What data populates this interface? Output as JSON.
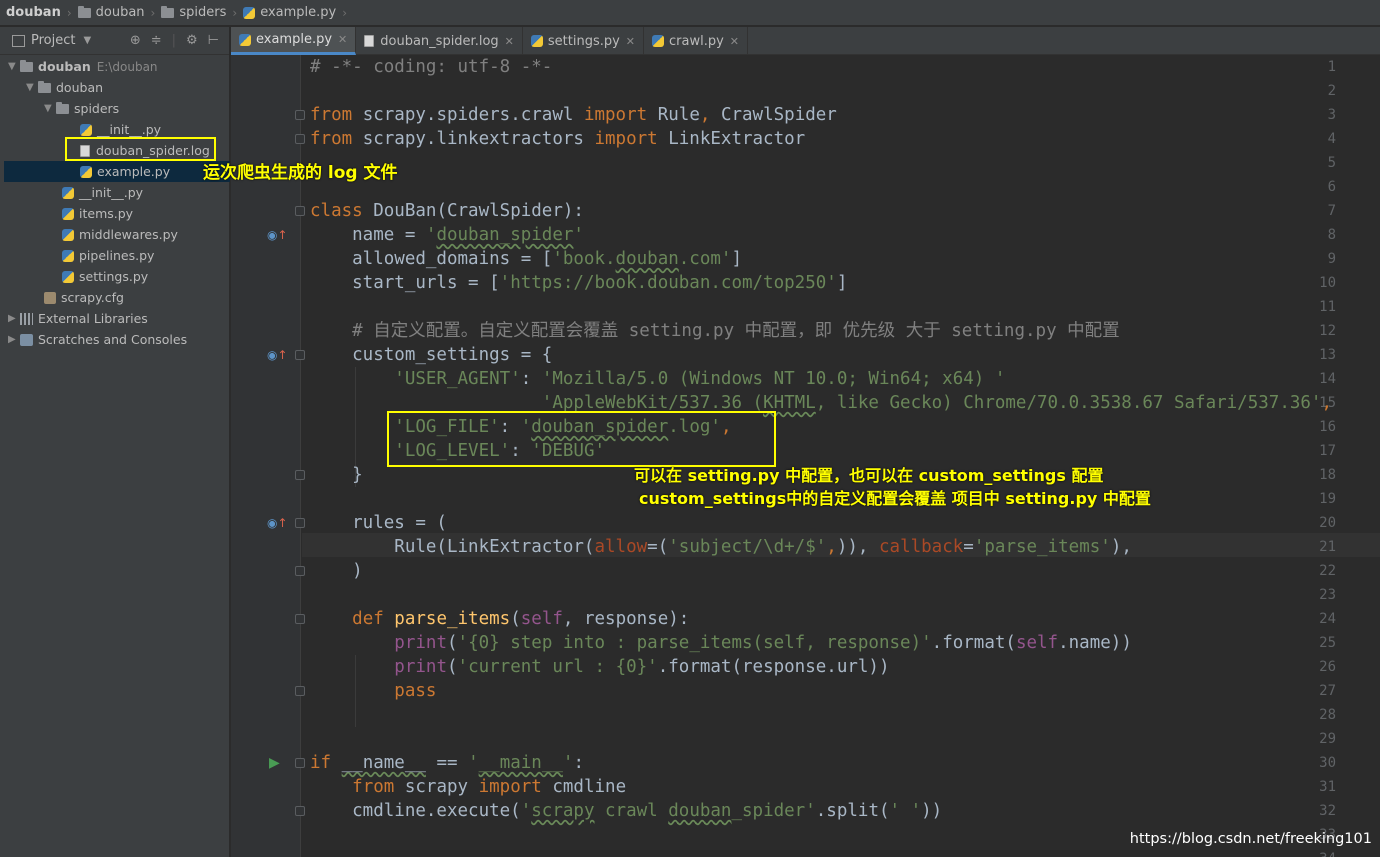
{
  "breadcrumb": {
    "root": "douban",
    "folder": "douban",
    "subfolder": "spiders",
    "file": "example.py"
  },
  "project_panel": {
    "title": "Project",
    "tree": [
      {
        "label": "douban",
        "path": "E:\\douban",
        "icon": "folder-icon"
      },
      {
        "label": "douban",
        "icon": "folder-icon"
      },
      {
        "label": "spiders",
        "icon": "folder-icon"
      },
      {
        "label": "__init__.py",
        "icon": "python-file-icon"
      },
      {
        "label": "douban_spider.log",
        "icon": "text-file-icon"
      },
      {
        "label": "example.py",
        "icon": "python-file-icon"
      },
      {
        "label": "__init__.py",
        "icon": "python-file-icon"
      },
      {
        "label": "items.py",
        "icon": "python-file-icon"
      },
      {
        "label": "middlewares.py",
        "icon": "python-file-icon"
      },
      {
        "label": "pipelines.py",
        "icon": "python-file-icon"
      },
      {
        "label": "settings.py",
        "icon": "python-file-icon"
      },
      {
        "label": "scrapy.cfg",
        "icon": "config-file-icon"
      },
      {
        "label": "External Libraries",
        "icon": "library-icon"
      },
      {
        "label": "Scratches and Consoles",
        "icon": "scratch-icon"
      }
    ]
  },
  "tabs": [
    {
      "label": "example.py",
      "active": true
    },
    {
      "label": "douban_spider.log",
      "active": false
    },
    {
      "label": "settings.py",
      "active": false
    },
    {
      "label": "crawl.py",
      "active": false
    }
  ],
  "editor": {
    "line_numbers": [
      "1",
      "2",
      "3",
      "4",
      "5",
      "6",
      "7",
      "8",
      "9",
      "10",
      "11",
      "12",
      "13",
      "14",
      "15",
      "16",
      "17",
      "18",
      "19",
      "20",
      "21",
      "22",
      "23",
      "24",
      "25",
      "26",
      "27",
      "28",
      "29",
      "30",
      "31",
      "32",
      "33",
      "34"
    ],
    "code": {
      "l1": "# -*- coding: utf-8 -*-",
      "l3a": "from",
      "l3b": " scrapy.spiders.crawl ",
      "l3c": "import",
      "l3d": " Rule",
      "l3e": ",",
      "l3f": " CrawlSpider",
      "l4a": "from",
      "l4b": " scrapy.linkextractors ",
      "l4c": "import",
      "l4d": " LinkExtractor",
      "l7a": "class",
      "l7b": " DouBan(CrawlSpider):",
      "l8a": "    name = ",
      "l8b": "'",
      "l8c": "douban_spider",
      "l8d": "'",
      "l9a": "    allowed_domains = [",
      "l9b": "'book.",
      "l9c": "douban",
      "l9d": ".com'",
      "l9e": "]",
      "l10a": "    start_urls = [",
      "l10b": "'https://book.douban.com/top250'",
      "l10c": "]",
      "l12": "    # 自定义配置。自定义配置会覆盖 setting.py 中配置，即 优先级 大于 setting.py 中配置",
      "l13": "    custom_settings = {",
      "l14a": "        ",
      "l14b": "'USER_AGENT'",
      "l14c": ": ",
      "l14d": "'Mozilla/5.0 (Windows NT 10.0; Win64; x64) '",
      "l15a": "                      ",
      "l15b": "'AppleWebKit/537.36 (",
      "l15c": "KHTML",
      "l15d": ", like Gecko) Chrome/70.0.3538.67 Safari/537.36'",
      "l15e": ",",
      "l16a": "        ",
      "l16b": "'LOG_FILE'",
      "l16c": ": ",
      "l16d": "'",
      "l16e": "douban_spider",
      "l16f": ".log'",
      "l16g": ",",
      "l17a": "        ",
      "l17b": "'LOG_LEVEL'",
      "l17c": ": ",
      "l17d": "'DEBUG'",
      "l18": "    }",
      "l20": "    rules = (",
      "l21a": "        Rule(LinkExtractor(",
      "l21b": "allow",
      "l21c": "=(",
      "l21d": "'subject/\\d+/$'",
      "l21e": ",",
      "l21f": ")), ",
      "l21g": "callback",
      "l21h": "=",
      "l21i": "'parse_items'",
      "l21j": "),",
      "l22": "    )",
      "l24a": "    ",
      "l24b": "def",
      "l24c": " parse_items",
      "l24d": "(",
      "l24e": "self",
      "l24f": ", response):",
      "l25a": "        ",
      "l25b": "print",
      "l25c": "(",
      "l25d": "'{0} step into : parse_items(self, response)'",
      "l25e": ".format(",
      "l25f": "self",
      "l25g": ".name))",
      "l26a": "        ",
      "l26b": "print",
      "l26c": "(",
      "l26d": "'current url : {0}'",
      "l26e": ".format(response.url))",
      "l27a": "        ",
      "l27b": "pass",
      "l30a": "if",
      "l30b": " ",
      "l30c": "__name__",
      "l30d": " == ",
      "l30e": "'",
      "l30f": "__main__",
      "l30g": "'",
      "l30h": ":",
      "l31a": "    ",
      "l31b": "from",
      "l31c": " scrapy ",
      "l31d": "import",
      "l31e": " cmdline",
      "l32a": "    cmdline.execute(",
      "l32b": "'",
      "l32c": "scrapy",
      "l32d": " crawl ",
      "l32e": "douban",
      "l32f": "_spider'",
      "l32g": ".split(",
      "l32h": "' '",
      "l32i": "))"
    }
  },
  "annotations": {
    "log_file_note": "运次爬虫生成的 log 文件",
    "settings_note_line1": "可以在 setting.py 中配置，也可以在 custom_settings 配置",
    "settings_note_line2": "custom_settings中的自定义配置会覆盖 项目中 setting.py 中配置"
  },
  "watermark": "https://blog.csdn.net/freeking101",
  "colors": {
    "keyword": "#cc7832",
    "string": "#6a8759",
    "comment": "#808080",
    "annotation": "#ffff00",
    "accent": "#4a88c7"
  }
}
